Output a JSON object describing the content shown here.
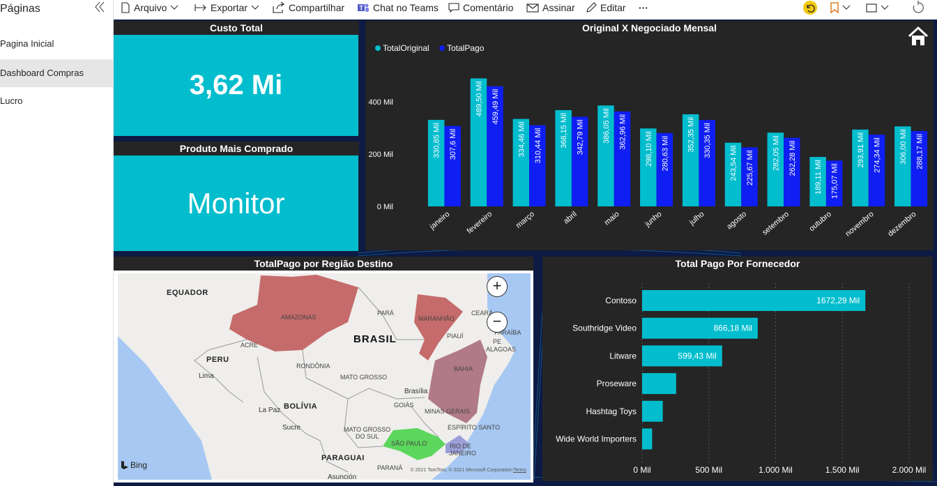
{
  "sidebar": {
    "title": "Páginas",
    "items": [
      {
        "label": "Pagina Inicial",
        "active": false
      },
      {
        "label": "Dashboard Compras",
        "active": true
      },
      {
        "label": "Lucro",
        "active": false
      }
    ]
  },
  "toolbar": {
    "file": "Arquivo",
    "export": "Exportar",
    "share": "Compartilhar",
    "teams": "Chat no Teams",
    "comment": "Comentário",
    "subscribe": "Assinar",
    "edit": "Editar",
    "more": "···"
  },
  "cards": {
    "custo_title": "Custo Total",
    "custo_value": "3,62 Mi",
    "produto_title": "Produto Mais Comprado",
    "produto_value": "Monitor"
  },
  "colors": {
    "teal": "#01bdcd",
    "blue": "#0f1ef2",
    "panel": "#252525",
    "navy": "#0c1a44"
  },
  "map": {
    "title": "TotalPago por Região Destino",
    "labels": {
      "equador": "EQUADOR",
      "amazonas": "AMAZONAS",
      "para": "PARÁ",
      "maranhao": "MARANHÃO",
      "ceara": "CEARÁ",
      "brasil": "BRASIL",
      "piaui": "PIAUÍ",
      "paraiba": "PARAÍBA",
      "alagoas": "ALAGOAS",
      "pe": "PE",
      "acre": "ACRE",
      "peru": "PERU",
      "lima": "Lima",
      "rondonia": "RONDÔNIA",
      "mato_grosso": "MATO GROSSO",
      "bahia": "BAHIA",
      "brasilia": "Brasília",
      "goias": "GOIÁS",
      "minas": "MINAS GERAIS",
      "la_paz": "La Paz",
      "bolivia": "BOLÍVIA",
      "sucre": "Sucre",
      "espirito": "ESPÍRITO SANTO",
      "mato_grosso_sul_1": "MATO GROSSO",
      "mato_grosso_sul_2": "DO SUL",
      "sao_paulo": "SÃO PAULO",
      "rio_1": "RIO DE",
      "rio_2": "JANEIRO",
      "paraguai": "PARAGUAI",
      "parana": "PARANÁ",
      "asuncion": "Asunción"
    },
    "bing": "Bing",
    "copyright": "© 2021 TomTom, © 2021 Microsoft Corporation",
    "terms": "Terms"
  },
  "chart_data": [
    {
      "type": "bar",
      "title": "Original X Negociado Mensal",
      "categories": [
        "janeiro",
        "fevereiro",
        "março",
        "abril",
        "maio",
        "junho",
        "julho",
        "agosto",
        "setembro",
        "outubro",
        "novembro",
        "dezembro"
      ],
      "series": [
        {
          "name": "TotalOriginal",
          "color": "#01bdcd",
          "values": [
            330.85,
            489.5,
            334.46,
            368.15,
            386.05,
            298.1,
            352.35,
            243.54,
            282.05,
            189.11,
            293.91,
            306.0
          ],
          "labels": [
            "330,85 Mil",
            "489,50 Mil",
            "334,46 Mil",
            "368,15 Mil",
            "386,05 Mil",
            "298,10 Mil",
            "352,35 Mil",
            "243,54 Mil",
            "282,05 Mil",
            "189,11 Mil",
            "293,91 Mil",
            "306,00 Mil"
          ]
        },
        {
          "name": "TotalPago",
          "color": "#0f1ef2",
          "values": [
            307.6,
            459.49,
            310.44,
            342.79,
            362.96,
            280.63,
            330.35,
            225.67,
            262.28,
            175.07,
            274.34,
            288.17
          ],
          "labels": [
            "307,6 Mil",
            "459,49 Mil",
            "310,44 Mil",
            "342,79 Mil",
            "362,96 Mil",
            "280,63 Mil",
            "330,35 Mil",
            "225,67 Mil",
            "262,28 Mil",
            "175,07 Mil",
            "274,34 Mil",
            "288,17 Mil"
          ]
        }
      ],
      "yticks": [
        "0 Mil",
        "200 Mil",
        "400 Mil"
      ],
      "ytick_values": [
        0,
        200,
        400
      ],
      "ylim": [
        0,
        500
      ],
      "legend": "top-left"
    },
    {
      "type": "bar",
      "orientation": "horizontal",
      "title": "Total Pago Por Fornecedor",
      "categories": [
        "Contoso",
        "Southridge Video",
        "Litware",
        "Proseware",
        "Hashtag Toys",
        "Wide World Importers"
      ],
      "values": [
        1672.29,
        866.18,
        599.43,
        255,
        155,
        75
      ],
      "labels": [
        "1672,29 Mil",
        "866,18 Mil",
        "599,43 Mil",
        "",
        "",
        ""
      ],
      "xticks": [
        "0 Mil",
        "500 Mil",
        "1.000 Mil",
        "1.500 Mil",
        "2.000 Mil"
      ],
      "xtick_values": [
        0,
        500,
        1000,
        1500,
        2000
      ],
      "xlim": [
        0,
        2000
      ],
      "color": "#01bdcd"
    }
  ]
}
